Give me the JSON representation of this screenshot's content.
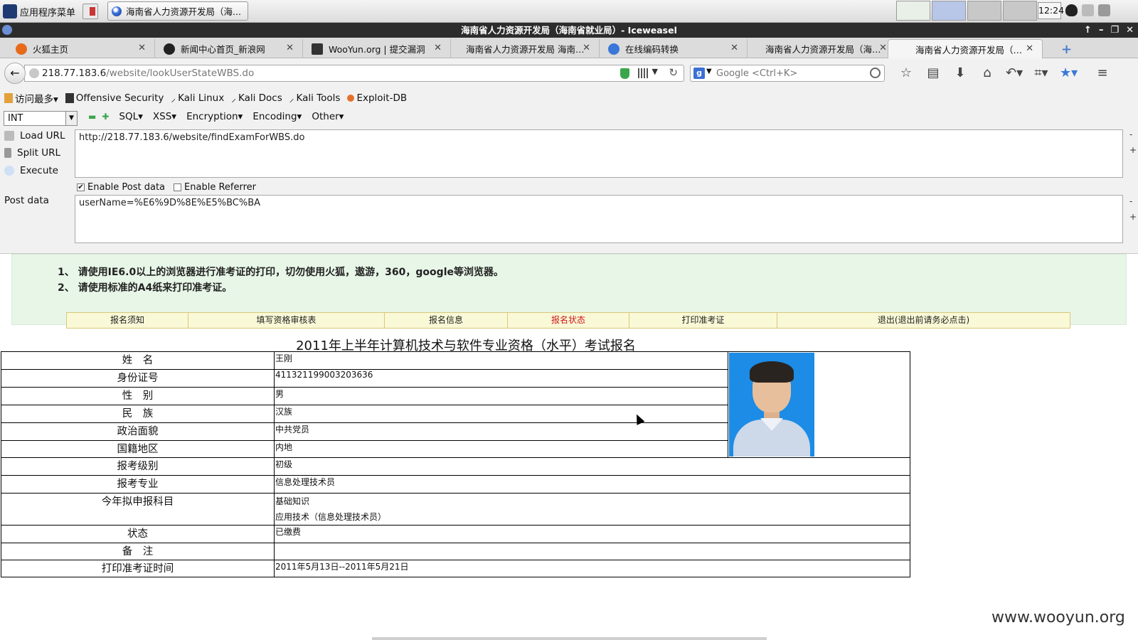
{
  "system": {
    "app_menu": "应用程序菜单",
    "task_window": "海南省人力资源开发局（海...",
    "clock": "12:24"
  },
  "window": {
    "title": "海南省人力资源开发局（海南省就业局）- Iceweasel"
  },
  "tabs": [
    {
      "label": "火狐主页",
      "icon": "firefox-icon",
      "color": "#e76a1a"
    },
    {
      "label": "新闻中心首页_新浪网",
      "icon": "sina-icon",
      "color": "#222222"
    },
    {
      "label": "WooYun.org | 提交漏洞",
      "icon": "wooyun-icon",
      "color": "#333333"
    },
    {
      "label": "海南省人力资源开发局 海南…",
      "icon": "",
      "color": ""
    },
    {
      "label": "在线编码转换",
      "icon": "chrome-icon",
      "color": "#3b77d8"
    },
    {
      "label": "海南省人力资源开发局（海…",
      "icon": "",
      "color": ""
    },
    {
      "label": "海南省人力资源开发局（海…",
      "icon": "",
      "color": ""
    }
  ],
  "nav": {
    "url_host": "218.77.183.6",
    "url_path": "/website/lookUserStateWBS.do",
    "search_placeholder": "Google <Ctrl+K>"
  },
  "bookmarks": [
    {
      "label": "访问最多▾",
      "icon": "folder-icon"
    },
    {
      "label": "Offensive Security",
      "icon": "offsec-icon"
    },
    {
      "label": "Kali Linux",
      "icon": "kali-icon"
    },
    {
      "label": "Kali Docs",
      "icon": "kali-icon"
    },
    {
      "label": "Kali Tools",
      "icon": "kali-icon"
    },
    {
      "label": "Exploit-DB",
      "icon": "exploitdb-icon"
    }
  ],
  "hackbar": {
    "type_select": "INT",
    "menus": [
      "SQL▾",
      "XSS▾",
      "Encryption▾",
      "Encoding▾",
      "Other▾"
    ],
    "load_url": "Load URL",
    "split_url": "Split URL",
    "execute": "Execute",
    "url_value": "http://218.77.183.6/website/findExamForWBS.do",
    "enable_post": "Enable Post data",
    "enable_referrer": "Enable Referrer",
    "post_label": "Post data",
    "post_value": "userName=%E6%9D%8E%E5%BC%BA"
  },
  "notice": {
    "line1": "1、 请使用IE6.0以上的浏览器进行准考证的打印，切勿使用火狐，遨游，360，google等浏览器。",
    "line2": "2、 请使用标准的A4纸来打印准考证。"
  },
  "page_nav": [
    "报名须知",
    "填写资格审核表",
    "报名信息",
    "报名状态",
    "打印准考证",
    "退出(退出前请务必点击)"
  ],
  "page_nav_active": "报名状态",
  "exam_title": "2011年上半年计算机技术与软件专业资格（水平）考试报名",
  "form": {
    "name_label": "姓　名",
    "name": "王刚",
    "id_label": "身份证号",
    "id": "411321199003203636",
    "sex_label": "性　别",
    "sex": "男",
    "ethnic_label": "民　族",
    "ethnic": "汉族",
    "political_label": "政治面貌",
    "political": "中共党员",
    "region_label": "国籍地区",
    "region": "内地",
    "level_label": "报考级别",
    "level": "初级",
    "major_label": "报考专业",
    "major": "信息处理技术员",
    "subjects_label": "今年拟申报科目",
    "subject1": "基础知识",
    "subject2": "应用技术（信息处理技术员）",
    "status_label": "状态",
    "status": "已缴费",
    "remark_label": "备　注",
    "remark": "",
    "print_time_label": "打印准考证时间",
    "print_time": "2011年5月13日--2011年5月21日"
  },
  "watermark": "www.wooyun.org"
}
